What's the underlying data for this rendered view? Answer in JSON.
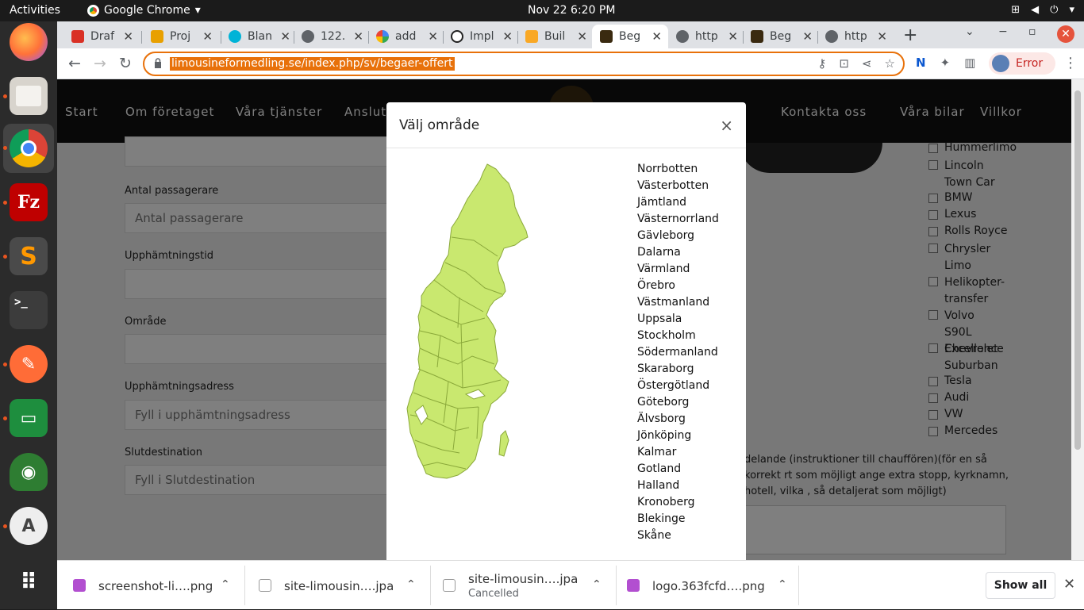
{
  "system_bar": {
    "activities": "Activities",
    "app_name": "Google Chrome",
    "clock": "Nov 22  6:20 PM"
  },
  "dock": {
    "items": [
      "firefox-icon",
      "files-icon",
      "chrome-icon",
      "filezilla-icon",
      "sublime-text-icon",
      "terminal-icon",
      "postman-icon",
      "google-chat-icon",
      "rocket-icon",
      "software-updater-icon",
      "app-grid-icon"
    ]
  },
  "tabs": [
    {
      "label": "Draf",
      "color": "#d93025"
    },
    {
      "label": "Proj",
      "color": "#e8a000"
    },
    {
      "label": "Blan",
      "color": "#00b3d7"
    },
    {
      "label": "122.",
      "color": "#5f6368"
    },
    {
      "label": "add",
      "color": "#4285f4"
    },
    {
      "label": "Impl",
      "color": "#222222"
    },
    {
      "label": "Buil",
      "color": "#f9a825"
    },
    {
      "label": "Beg",
      "color": "#3a2a10"
    },
    {
      "label": "http",
      "color": "#5f6368"
    },
    {
      "label": "Beg",
      "color": "#3a2a10"
    },
    {
      "label": "http",
      "color": "#5f6368"
    }
  ],
  "toolbar": {
    "url": "limousineformedling.se/index.php/sv/begaer-offert",
    "profile_status": "Error"
  },
  "site_nav": {
    "links": [
      "Start",
      "Om företaget",
      "Våra tjänster",
      "Anslut",
      "Kontakta oss",
      "Våra bilar",
      "Villkor"
    ]
  },
  "form": {
    "passengers_label": "Antal passagerare",
    "passengers_placeholder": "Antal passagerare",
    "pickup_time_label": "Upphämtningstid",
    "area_label": "Område",
    "pickup_address_label": "Upphämtningsadress",
    "pickup_address_placeholder": "Fyll i upphämtningsadress",
    "destination_label": "Slutdestination",
    "destination_placeholder": "Fyll i Slutdestination",
    "notes_text": "delande (instruktioner till chauffören)(för en så korrekt rt som möjligt ange extra stopp, kyrknamn, hotell, vilka , så detaljerat som möjligt)"
  },
  "car_options": [
    "Hummerlimo",
    "Lincoln Town Car",
    "BMW",
    "Lexus",
    "Rolls Royce",
    "Chrysler Limo",
    "Helikopter-transfer",
    "Volvo S90L Excellence",
    "Chevrolet Suburban",
    "Tesla",
    "Audi",
    "VW",
    "Mercedes"
  ],
  "modal": {
    "title": "Välj område",
    "close": "×",
    "map_fill": "#c9e86f",
    "regions": [
      "Norrbotten",
      "Västerbotten",
      "Jämtland",
      "Västernorrland",
      "Gävleborg",
      "Dalarna",
      "Värmland",
      "Örebro",
      "Västmanland",
      "Uppsala",
      "Stockholm",
      "Södermanland",
      "Skaraborg",
      "Östergötland",
      "Göteborg",
      "Älvsborg",
      "Jönköping",
      "Kalmar",
      "Gotland",
      "Halland",
      "Kronoberg",
      "Blekinge",
      "Skåne"
    ]
  },
  "downloads": [
    {
      "name": "screenshot-li….png",
      "status": ""
    },
    {
      "name": "site-limousin….jpa",
      "status": ""
    },
    {
      "name": "site-limousin….jpa",
      "status": "Cancelled"
    },
    {
      "name": "logo.363fcfd….png",
      "status": ""
    }
  ],
  "shelf": {
    "show_all": "Show all"
  }
}
